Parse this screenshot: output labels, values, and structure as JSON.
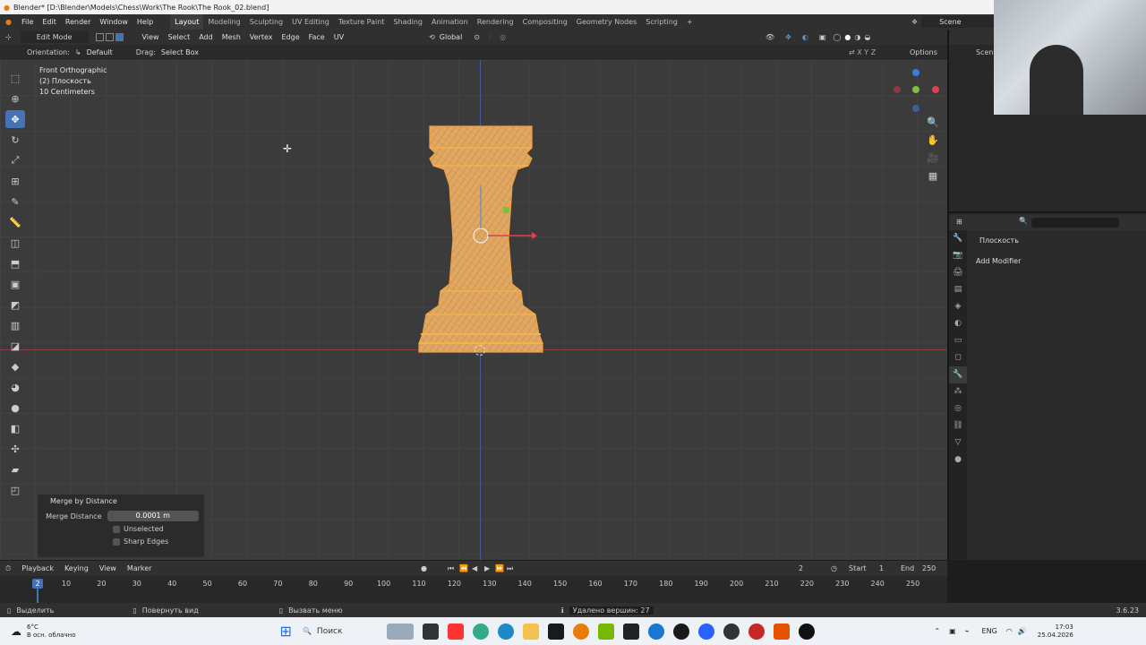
{
  "titlebar": {
    "title": "Blender* [D:\\Blender\\Models\\Chess\\Work\\The Rook\\The Rook_02.blend]"
  },
  "topbar": {
    "menus": [
      "File",
      "Edit",
      "Render",
      "Window",
      "Help"
    ],
    "workspaces": [
      "Layout",
      "Modeling",
      "Sculpting",
      "UV Editing",
      "Texture Paint",
      "Shading",
      "Animation",
      "Rendering",
      "Compositing",
      "Geometry Nodes",
      "Scripting"
    ],
    "add_tab": "+",
    "scene": "Scene"
  },
  "header": {
    "mode": "Edit Mode",
    "menus": [
      "View",
      "Select",
      "Add",
      "Mesh",
      "Vertex",
      "Edge",
      "Face",
      "UV"
    ],
    "transform_orientation": "Global",
    "options": "Options"
  },
  "tool_settings": {
    "orientation_label": "Orientation:",
    "orientation_value": "Default",
    "drag_label": "Drag:",
    "drag_value": "Select Box"
  },
  "viewport": {
    "view_name": "Front Orthographic",
    "object_info": "(2) Плоскость",
    "grid_scale": "10 Centimeters"
  },
  "operator_panel": {
    "title": "Merge by Distance",
    "merge_distance_label": "Merge Distance",
    "merge_distance_value": "0.0001 m",
    "unselected": "Unselected",
    "sharp_edges": "Sharp Edges"
  },
  "properties": {
    "object_name": "Плоскость",
    "add_modifier": "Add Modifier"
  },
  "timeline": {
    "menus": [
      "Playback",
      "Keying",
      "View",
      "Marker"
    ],
    "current_frame": "2",
    "start_label": "Start",
    "start_value": "1",
    "end_label": "End",
    "end_value": "250",
    "ticks": [
      "10",
      "20",
      "30",
      "40",
      "50",
      "60",
      "70",
      "80",
      "90",
      "100",
      "110",
      "120",
      "130",
      "140",
      "150",
      "160",
      "170",
      "180",
      "190",
      "200",
      "210",
      "220",
      "230",
      "240",
      "250"
    ],
    "frame_marker": "2"
  },
  "statusbar": {
    "select": "Выделить",
    "rotate_view": "Повернуть вид",
    "call_menu": "Вызвать меню",
    "message": "Удалено вершин: 27",
    "version": "3.6.23"
  },
  "taskbar": {
    "weather_temp": "6°C",
    "weather_desc": "В осн. облачно",
    "search": "Поиск",
    "lang": "ENG",
    "time": "17:03",
    "date": "25.04.2026"
  },
  "colors": {
    "accent": "#4772b3",
    "mesh": "#e89b3c",
    "x_axis": "#8a3b44",
    "z_axis": "#3c5f9a"
  }
}
